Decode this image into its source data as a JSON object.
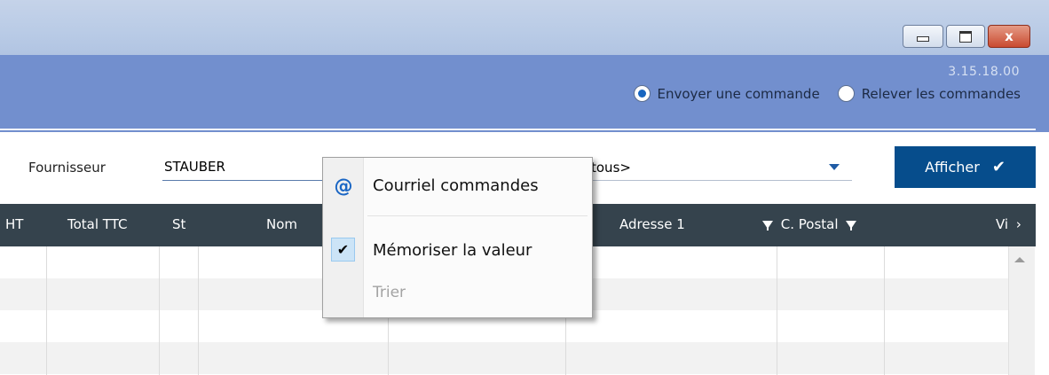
{
  "window": {
    "controls": {
      "minimize": "minimize",
      "maximize": "maximize",
      "close": "x"
    }
  },
  "header": {
    "version": "3.15.18.00",
    "radio_options": [
      {
        "label": "Envoyer une commande",
        "selected": true
      },
      {
        "label": "Relever les commandes",
        "selected": false
      }
    ]
  },
  "filter": {
    "supplier_label": "Fournisseur",
    "supplier_value": "STAUBER",
    "second_select_value": "tous>",
    "show_button_label": "Afficher"
  },
  "table": {
    "columns": [
      "HT",
      "Total TTC",
      "St",
      "Nom",
      "Adresse 1",
      "C. Postal",
      "Vi"
    ]
  },
  "context_menu": {
    "items": [
      {
        "label": "Courriel commandes",
        "icon": "at-icon",
        "disabled": false
      },
      {
        "label": "Mémoriser la valeur",
        "icon": "check-icon",
        "checked": true,
        "disabled": false
      },
      {
        "label": "Trier",
        "disabled": true
      }
    ]
  },
  "colors": {
    "band": "#728fce",
    "header_row": "#35434d",
    "primary_button": "#064d8c",
    "accent": "#1765c0"
  }
}
